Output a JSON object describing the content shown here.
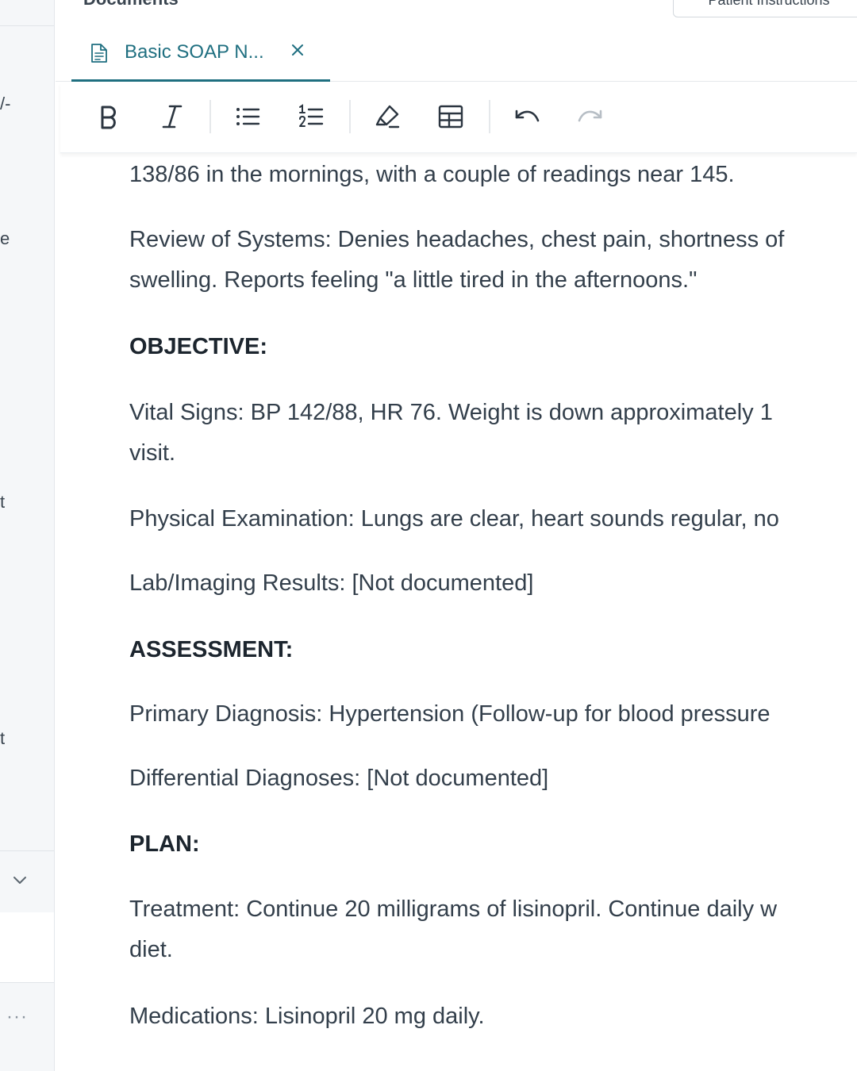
{
  "sidebar": {
    "fragments": [
      "/-",
      "e",
      "t",
      "t"
    ],
    "more_label": "···"
  },
  "header": {
    "section_title": "Documents",
    "patient_button": "Patient Instructions"
  },
  "tab": {
    "label": "Basic SOAP N..."
  },
  "toolbar": {
    "buttons": [
      "bold",
      "italic",
      "bullet-list",
      "numbered-list",
      "highlight",
      "table",
      "undo",
      "redo"
    ]
  },
  "document": {
    "p1": "138/86 in the mornings, with a couple of readings near 145.",
    "p2_l1": "Review of Systems: Denies headaches, chest pain, shortness of",
    "p2_l2": "swelling. Reports feeling \"a little tired in the afternoons.\"",
    "h_objective": "OBJECTIVE:",
    "p3_l1": "Vital Signs: BP 142/88, HR 76. Weight is down approximately 1",
    "p3_l2": "visit.",
    "p4": "Physical Examination: Lungs are clear, heart sounds regular, no",
    "p5": "Lab/Imaging Results: [Not documented]",
    "h_assessment": "ASSESSMENT:",
    "p6": "Primary Diagnosis: Hypertension (Follow-up for blood pressure",
    "p7": "Differential Diagnoses: [Not documented]",
    "h_plan": "PLAN:",
    "p8_l1": "Treatment: Continue 20 milligrams of lisinopril. Continue daily w",
    "p8_l2": "diet.",
    "p9": "Medications: Lisinopril 20 mg daily."
  },
  "colors": {
    "accent": "#1f6f80",
    "text": "#333f4b",
    "heading": "#1c252e"
  }
}
